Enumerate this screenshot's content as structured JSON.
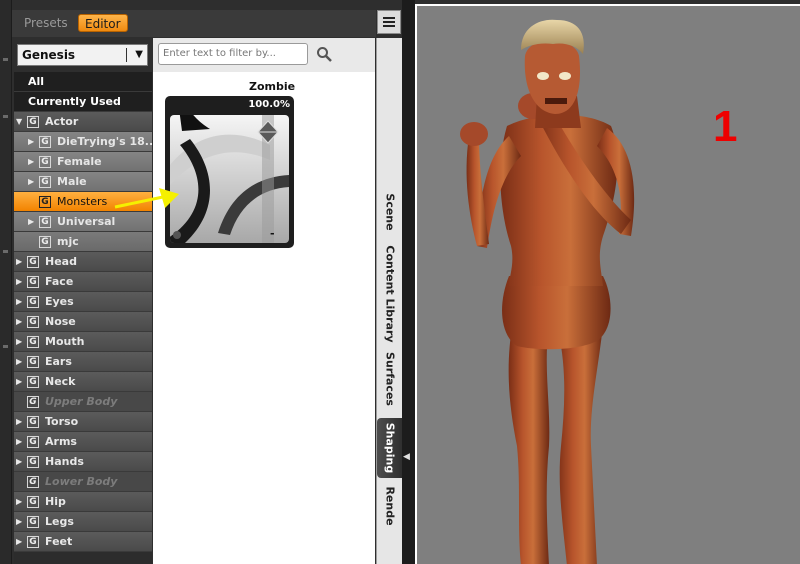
{
  "tabs": {
    "presets": "Presets",
    "editor": "Editor"
  },
  "figure_selector": {
    "value": "Genesis"
  },
  "filter": {
    "placeholder": "Enter text to filter by..."
  },
  "tree": {
    "all": "All",
    "currently_used": "Currently Used",
    "items": [
      {
        "label": "Actor",
        "level": 0,
        "state": "expanded",
        "style": "cat"
      },
      {
        "label": "DieTrying's 18...",
        "level": 1,
        "state": "collapsed",
        "style": "sub"
      },
      {
        "label": "Female",
        "level": 1,
        "state": "collapsed",
        "style": "sub"
      },
      {
        "label": "Male",
        "level": 1,
        "state": "collapsed",
        "style": "sub"
      },
      {
        "label": "Monsters",
        "level": 1,
        "state": "leaf",
        "style": "selected"
      },
      {
        "label": "Universal",
        "level": 1,
        "state": "collapsed",
        "style": "sub"
      },
      {
        "label": "mjc",
        "level": 1,
        "state": "leaf",
        "style": "sub leaf"
      },
      {
        "label": "Head",
        "level": 0,
        "state": "collapsed",
        "style": "cat"
      },
      {
        "label": "Face",
        "level": 0,
        "state": "collapsed",
        "style": "cat"
      },
      {
        "label": "Eyes",
        "level": 0,
        "state": "collapsed",
        "style": "cat"
      },
      {
        "label": "Nose",
        "level": 0,
        "state": "collapsed",
        "style": "cat"
      },
      {
        "label": "Mouth",
        "level": 0,
        "state": "collapsed",
        "style": "cat"
      },
      {
        "label": "Ears",
        "level": 0,
        "state": "collapsed",
        "style": "cat"
      },
      {
        "label": "Neck",
        "level": 0,
        "state": "collapsed",
        "style": "cat"
      },
      {
        "label": "Upper Body",
        "level": 0,
        "state": "leaf",
        "style": "dim"
      },
      {
        "label": "Torso",
        "level": 0,
        "state": "collapsed",
        "style": "cat"
      },
      {
        "label": "Arms",
        "level": 0,
        "state": "collapsed",
        "style": "cat"
      },
      {
        "label": "Hands",
        "level": 0,
        "state": "collapsed",
        "style": "cat"
      },
      {
        "label": "Lower Body",
        "level": 0,
        "state": "leaf",
        "style": "dim"
      },
      {
        "label": "Hip",
        "level": 0,
        "state": "collapsed",
        "style": "cat"
      },
      {
        "label": "Legs",
        "level": 0,
        "state": "collapsed",
        "style": "cat"
      },
      {
        "label": "Feet",
        "level": 0,
        "state": "collapsed",
        "style": "cat"
      }
    ]
  },
  "morph_tile": {
    "title": "Zombie",
    "value": "100.0%",
    "minus": "-"
  },
  "side_tabs": [
    {
      "label": "Scene",
      "active": false
    },
    {
      "label": "Content Library",
      "active": false
    },
    {
      "label": "Surfaces",
      "active": false
    },
    {
      "label": "Shaping",
      "active": true
    },
    {
      "label": "Rende",
      "active": false
    }
  ],
  "viewport": {
    "number_label": "1"
  },
  "colors": {
    "accent": "#f28300",
    "annotation_arrow": "#f5f000",
    "number": "#ee0000"
  },
  "icons": {
    "tree_expanded": "▼",
    "tree_collapsed": "▶",
    "group": "G",
    "dropdown": "▼",
    "collapse": "◀"
  }
}
